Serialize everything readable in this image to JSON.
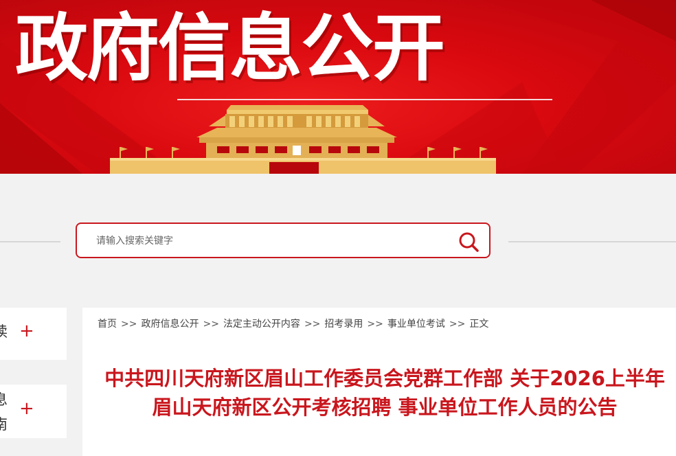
{
  "banner": {
    "title": "政府信息公开"
  },
  "colors": {
    "accent": "#c9161d",
    "banner_red": "#d9090f",
    "gold": "#e9b85a"
  },
  "search": {
    "placeholder": "请输入搜索关键字",
    "icon": "search-icon"
  },
  "sidebar": {
    "items": [
      {
        "label_partial": "读",
        "toggle": "+"
      },
      {
        "label_partial_line1": "息",
        "label_partial_line2": "南",
        "toggle": "+"
      }
    ]
  },
  "breadcrumb": {
    "separator": ">>",
    "items": [
      "首页",
      "政府信息公开",
      "法定主动公开内容",
      "招考录用",
      "事业单位考试",
      "正文"
    ]
  },
  "article": {
    "title": "中共四川天府新区眉山工作委员会党群工作部 关于2026上半年眉山天府新区公开考核招聘 事业单位工作人员的公告"
  }
}
